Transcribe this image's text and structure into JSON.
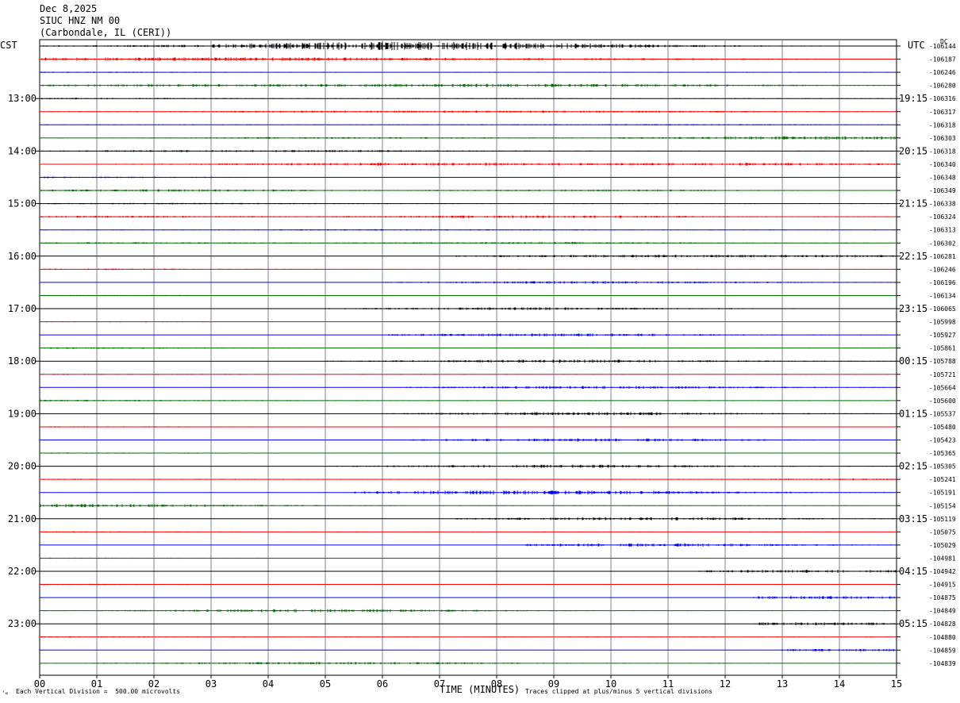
{
  "header": {
    "line1": "Dec 8,2025",
    "line2": "SIUC HNZ NM 00",
    "line3": "(Carbondale, IL (CERI))"
  },
  "left_axis_label": "CST",
  "right_axis_label": "UTC",
  "dc_label": "DC",
  "footer": {
    "x_axis_title": "TIME (MINUTES)",
    "scale_note": "Each Vertical Division =  500.00 microvolts",
    "clip_note": "Traces clipped at plus/minus 5 vertical divisions",
    "corner_mark": "‘«"
  },
  "chart_data": {
    "type": "line",
    "title": "Dec 8,2025 SIUC HNZ NM 00 (Carbondale, IL (CERI))",
    "xlabel": "TIME (MINUTES)",
    "xlim": [
      0,
      15
    ],
    "x_ticks": [
      "00",
      "01",
      "02",
      "03",
      "04",
      "05",
      "06",
      "07",
      "08",
      "09",
      "10",
      "11",
      "12",
      "13",
      "14",
      "15"
    ],
    "trace_colors": [
      "#000000",
      "#ff0000",
      "#0000ff",
      "#007000"
    ],
    "grid": true,
    "cst_labels": [
      "13:00",
      "14:00",
      "15:00",
      "16:00",
      "17:00",
      "18:00",
      "19:00",
      "20:00",
      "21:00",
      "22:00",
      "23:00"
    ],
    "utc_labels": [
      "19:15",
      "20:15",
      "21:15",
      "22:15",
      "23:15",
      "00:15",
      "01:15",
      "02:15",
      "03:15",
      "04:15",
      "05:15"
    ],
    "dc_values": [
      "106144",
      "106187",
      "106246",
      "106280",
      "106316",
      "106317",
      "106318",
      "106303",
      "106318",
      "106340",
      "106348",
      "106349",
      "106338",
      "106324",
      "106313",
      "106302",
      "106281",
      "106246",
      "106196",
      "106134",
      "106065",
      "105998",
      "105927",
      "105861",
      "105788",
      "105721",
      "105664",
      "105600",
      "105537",
      "105480",
      "105423",
      "105365",
      "105305",
      "105241",
      "105191",
      "105154",
      "105119",
      "105075",
      "105029",
      "104981",
      "104942",
      "104915",
      "104875",
      "104849",
      "104828",
      "104880",
      "104859",
      "104839"
    ],
    "activity": [
      [
        [
          0.05,
          0.1
        ],
        [
          5.2,
          0.8
        ],
        [
          6.4,
          0.6
        ],
        [
          8.5,
          0.8
        ]
      ],
      [
        [
          1.2,
          0.5
        ],
        [
          4.2,
          0.35
        ],
        [
          6.3,
          0.2
        ],
        [
          10.3,
          0.25
        ]
      ],
      [
        [
          0.2,
          0.1
        ]
      ],
      [
        [
          2.2,
          0.35
        ],
        [
          7.3,
          0.5
        ],
        [
          11.2,
          0.3
        ]
      ],
      [
        [
          0.4,
          0.2
        ]
      ],
      [
        [
          5.3,
          0.3
        ],
        [
          9.8,
          0.3
        ]
      ],
      [
        [
          10.8,
          0.15
        ]
      ],
      [
        [
          5.1,
          0.25
        ],
        [
          13.2,
          0.35
        ],
        [
          15.0,
          0.3
        ]
      ],
      [
        [
          2.5,
          0.2
        ],
        [
          5.5,
          0.2
        ]
      ],
      [
        [
          5.0,
          0.3
        ],
        [
          8.0,
          0.3
        ],
        [
          12.8,
          0.4
        ]
      ],
      [
        [
          0.5,
          0.2
        ]
      ],
      [
        [
          2.3,
          0.4
        ],
        [
          9.8,
          0.3
        ]
      ],
      [
        [
          2.6,
          0.15
        ]
      ],
      [
        [
          1.0,
          0.3
        ],
        [
          8.6,
          0.45
        ]
      ],
      [
        [
          6.5,
          0.15
        ]
      ],
      [
        [
          1.3,
          0.2
        ],
        [
          8.6,
          0.3
        ]
      ],
      [
        [
          10.2,
          0.35
        ],
        [
          14.0,
          0.3
        ]
      ],
      [
        [
          0.3,
          0.2
        ]
      ],
      [
        [
          9.8,
          0.45
        ]
      ],
      [
        [
          0.2,
          0.1
        ]
      ],
      [
        [
          8.5,
          0.45
        ]
      ],
      [
        [
          0.6,
          0.1
        ]
      ],
      [
        [
          9.0,
          0.5
        ]
      ],
      [
        [
          0.5,
          0.2
        ]
      ],
      [
        [
          9.3,
          0.55
        ]
      ],
      [
        [
          0.4,
          0.1
        ]
      ],
      [
        [
          9.8,
          0.5
        ]
      ],
      [
        [
          0.5,
          0.2
        ]
      ],
      [
        [
          9.5,
          0.55
        ]
      ],
      [
        [
          0.3,
          0.1
        ]
      ],
      [
        [
          9.6,
          0.55
        ]
      ],
      [
        [
          0.3,
          0.1
        ]
      ],
      [
        [
          9.2,
          0.55
        ]
      ],
      [
        [
          0.2,
          0.1
        ],
        [
          14.5,
          0.2
        ]
      ],
      [
        [
          7.8,
          0.6
        ],
        [
          10.5,
          0.3
        ]
      ],
      [
        [
          0.5,
          0.35
        ],
        [
          1.5,
          0.2
        ]
      ],
      [
        [
          10.5,
          0.5
        ]
      ],
      [
        [
          0.2,
          0.1
        ]
      ],
      [
        [
          10.5,
          0.55
        ]
      ],
      [
        [
          0.2,
          0.1
        ]
      ],
      [
        [
          13.5,
          0.5
        ]
      ],
      [
        [
          0.5,
          0.1
        ]
      ],
      [
        [
          13.5,
          0.5
        ]
      ],
      [
        [
          4.8,
          0.55
        ]
      ],
      [
        [
          13.2,
          0.5
        ]
      ],
      [
        [
          0.5,
          0.1
        ]
      ],
      [
        [
          14.2,
          0.35
        ]
      ],
      [
        [
          5.2,
          0.4
        ]
      ]
    ],
    "trace_spans": [
      [
        0,
        15
      ],
      [
        0,
        15
      ],
      [
        0,
        15
      ],
      [
        0,
        15
      ],
      [
        0,
        15
      ],
      [
        0,
        15
      ],
      [
        0,
        15
      ],
      [
        0,
        15
      ],
      [
        0,
        15
      ],
      [
        0,
        15
      ],
      [
        0,
        15
      ],
      [
        0,
        15
      ],
      [
        0,
        15
      ],
      [
        0,
        15
      ],
      [
        0,
        15
      ],
      [
        0,
        15
      ],
      [
        7.3,
        15
      ],
      [
        0,
        15
      ],
      [
        6,
        15
      ],
      [
        0,
        15
      ],
      [
        5,
        15
      ],
      [
        0,
        15
      ],
      [
        6,
        15
      ],
      [
        0,
        15
      ],
      [
        5,
        15
      ],
      [
        0,
        15
      ],
      [
        6.2,
        15
      ],
      [
        0,
        15
      ],
      [
        6,
        15
      ],
      [
        0,
        15
      ],
      [
        6.5,
        15
      ],
      [
        0,
        15
      ],
      [
        5,
        15
      ],
      [
        0,
        15
      ],
      [
        5.5,
        15
      ],
      [
        0,
        15
      ],
      [
        7.3,
        15
      ],
      [
        0,
        15
      ],
      [
        8.5,
        15
      ],
      [
        0,
        15
      ],
      [
        11.5,
        15
      ],
      [
        0,
        15
      ],
      [
        12.5,
        15
      ],
      [
        0,
        15
      ],
      [
        12.5,
        15
      ],
      [
        0,
        15
      ],
      [
        13,
        15
      ],
      [
        0,
        15
      ]
    ]
  }
}
